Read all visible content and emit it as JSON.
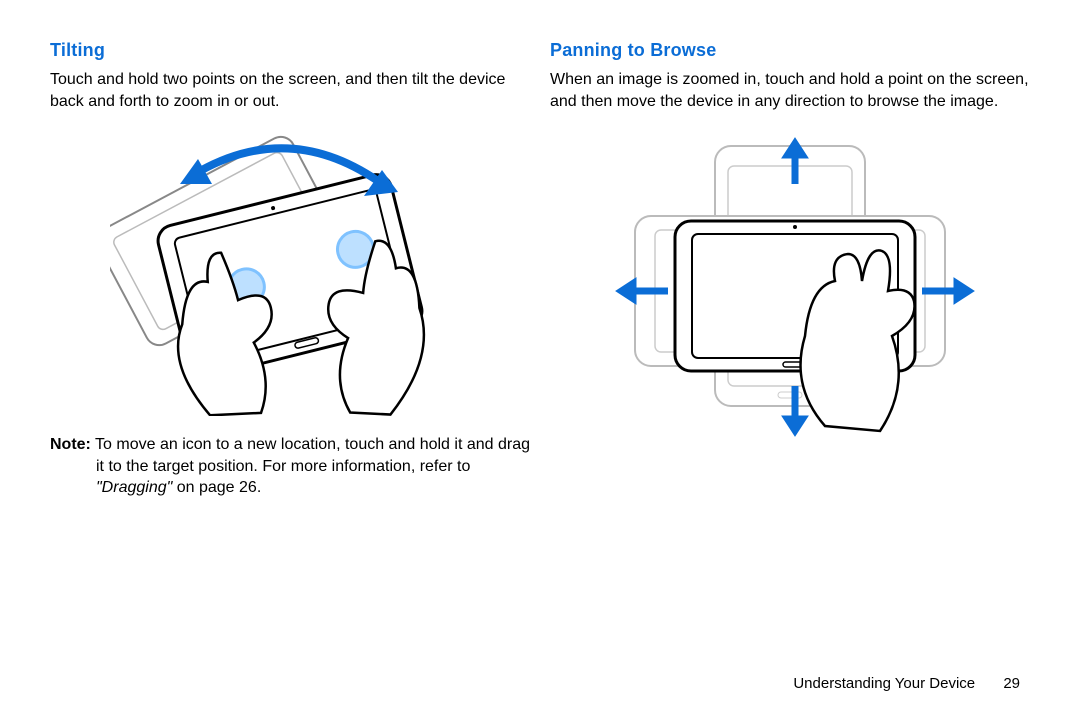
{
  "left": {
    "heading": "Tilting",
    "body": "Touch and hold two points on the screen, and then tilt the device back and forth to zoom in or out.",
    "note_label": "Note:",
    "note_body_1": " To move an icon to a new location, touch and hold it and drag it to the target position. For more information, refer to ",
    "note_ref": "\"Dragging\"",
    "note_body_2": " on page 26."
  },
  "right": {
    "heading": "Panning to Browse",
    "body": "When an image is zoomed in, touch and hold a point on the screen, and then move the device in any direction to browse the image."
  },
  "footer": {
    "section": "Understanding Your Device",
    "page": "29"
  }
}
